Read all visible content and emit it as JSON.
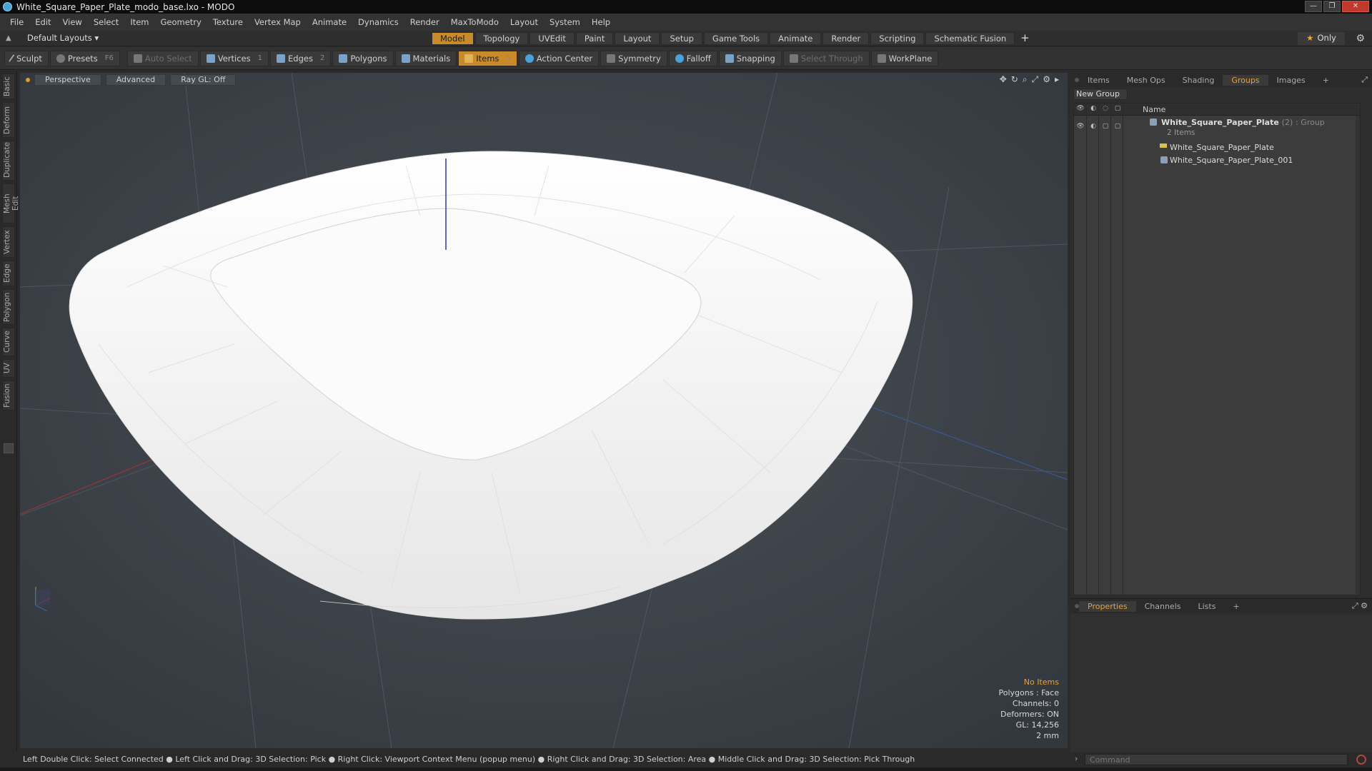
{
  "window": {
    "title": "White_Square_Paper_Plate_modo_base.lxo - MODO",
    "controls": [
      "minimize",
      "restore",
      "close"
    ]
  },
  "menu": [
    "File",
    "Edit",
    "View",
    "Select",
    "Item",
    "Geometry",
    "Texture",
    "Vertex Map",
    "Animate",
    "Dynamics",
    "Render",
    "MaxToModo",
    "Layout",
    "System",
    "Help"
  ],
  "layoutbar": {
    "layouts_label": "Default Layouts ▾",
    "tabs": [
      "Model",
      "Topology",
      "UVEdit",
      "Paint",
      "Layout",
      "Setup",
      "Game Tools",
      "Animate",
      "Render",
      "Scripting",
      "Schematic Fusion"
    ],
    "active_tab": "Model",
    "add_label": "+",
    "only_label": "Only"
  },
  "toolbar": {
    "sculpt": "Sculpt",
    "presets": "Presets",
    "presets_key": "F6",
    "auto_select": "Auto Select",
    "vertices": "Vertices",
    "vertices_count": "1",
    "edges": "Edges",
    "edges_count": "2",
    "polygons": "Polygons",
    "materials": "Materials",
    "items": "Items",
    "items_count": "5",
    "action_center": "Action Center",
    "symmetry": "Symmetry",
    "falloff": "Falloff",
    "snapping": "Snapping",
    "select_through": "Select Through",
    "workplane": "WorkPlane"
  },
  "left_tabs": [
    "Basic",
    "Deform",
    "Duplicate",
    "Mesh Edit",
    "Vertex",
    "Edge",
    "Polygon",
    "Curve",
    "UV",
    "Fusion"
  ],
  "viewport": {
    "view_mode": "Perspective",
    "shading": "Advanced",
    "raygl": "Ray GL: Off",
    "info": {
      "no_items": "No Items",
      "polygons": "Polygons : Face",
      "channels": "Channels: 0",
      "deformers": "Deformers: ON",
      "gl": "GL: 14,256",
      "scale": "2 mm"
    }
  },
  "right_panel": {
    "tabs": [
      "Items",
      "Mesh Ops",
      "Shading",
      "Groups",
      "Images"
    ],
    "active_tab": "Groups",
    "add_label": "+",
    "new_group": "New Group",
    "name_header": "Name",
    "group": {
      "name": "White_Square_Paper_Plate",
      "count": "(2)",
      "kind": ": Group",
      "sub": "2 Items"
    },
    "items": [
      "White_Square_Paper_Plate",
      "White_Square_Paper_Plate_001"
    ]
  },
  "properties_panel": {
    "tabs": [
      "Properties",
      "Channels",
      "Lists"
    ],
    "active_tab": "Properties",
    "add_label": "+"
  },
  "statusbar": {
    "text": "Left Double Click: Select Connected ● Left Click and Drag: 3D Selection: Pick ● Right Click: Viewport Context Menu (popup menu) ● Right Click and Drag: 3D Selection: Area ● Middle Click and Drag: 3D Selection: Pick Through"
  },
  "command": {
    "placeholder": "Command"
  },
  "colors": {
    "accent": "#c88a2a",
    "viewport_bg": "#3b4148",
    "warn_text": "#e6a23c"
  }
}
